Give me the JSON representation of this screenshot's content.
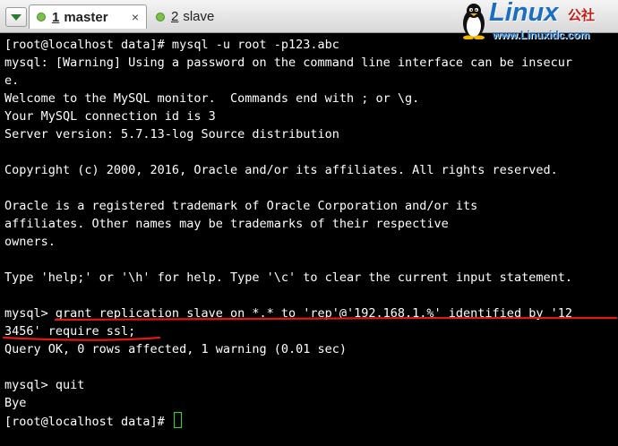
{
  "tabs": [
    {
      "number": "1",
      "label": "master",
      "active": true,
      "close_symbol": "×"
    },
    {
      "number": "2",
      "label": "slave",
      "active": false
    }
  ],
  "watermark": {
    "logo": "Linux",
    "logo_suffix": "公社",
    "url": "www.Linuxidc.com"
  },
  "terminal": {
    "lines": [
      "[root@localhost data]# mysql -u root -p123.abc",
      "mysql: [Warning] Using a password on the command line interface can be insecur",
      "e.",
      "Welcome to the MySQL monitor.  Commands end with ; or \\g.",
      "Your MySQL connection id is 3",
      "Server version: 5.7.13-log Source distribution",
      "",
      "Copyright (c) 2000, 2016, Oracle and/or its affiliates. All rights reserved.",
      "",
      "Oracle is a registered trademark of Oracle Corporation and/or its",
      "affiliates. Other names may be trademarks of their respective",
      "owners.",
      "",
      "Type 'help;' or '\\h' for help. Type '\\c' to clear the current input statement.",
      "",
      "mysql> grant replication slave on *.* to 'rep'@'192.168.1.%' identified by '12",
      "3456' require ssl;",
      "Query OK, 0 rows affected, 1 warning (0.01 sec)",
      "",
      "mysql> quit",
      "Bye",
      "[root@localhost data]# "
    ]
  },
  "colors": {
    "terminal_background": "#000000",
    "terminal_text": "#ffffff",
    "cursor": "#22dd22",
    "annotation_underline": "#e01818",
    "watermark_blue": "#1a6fc2",
    "watermark_red": "#c0201a"
  }
}
